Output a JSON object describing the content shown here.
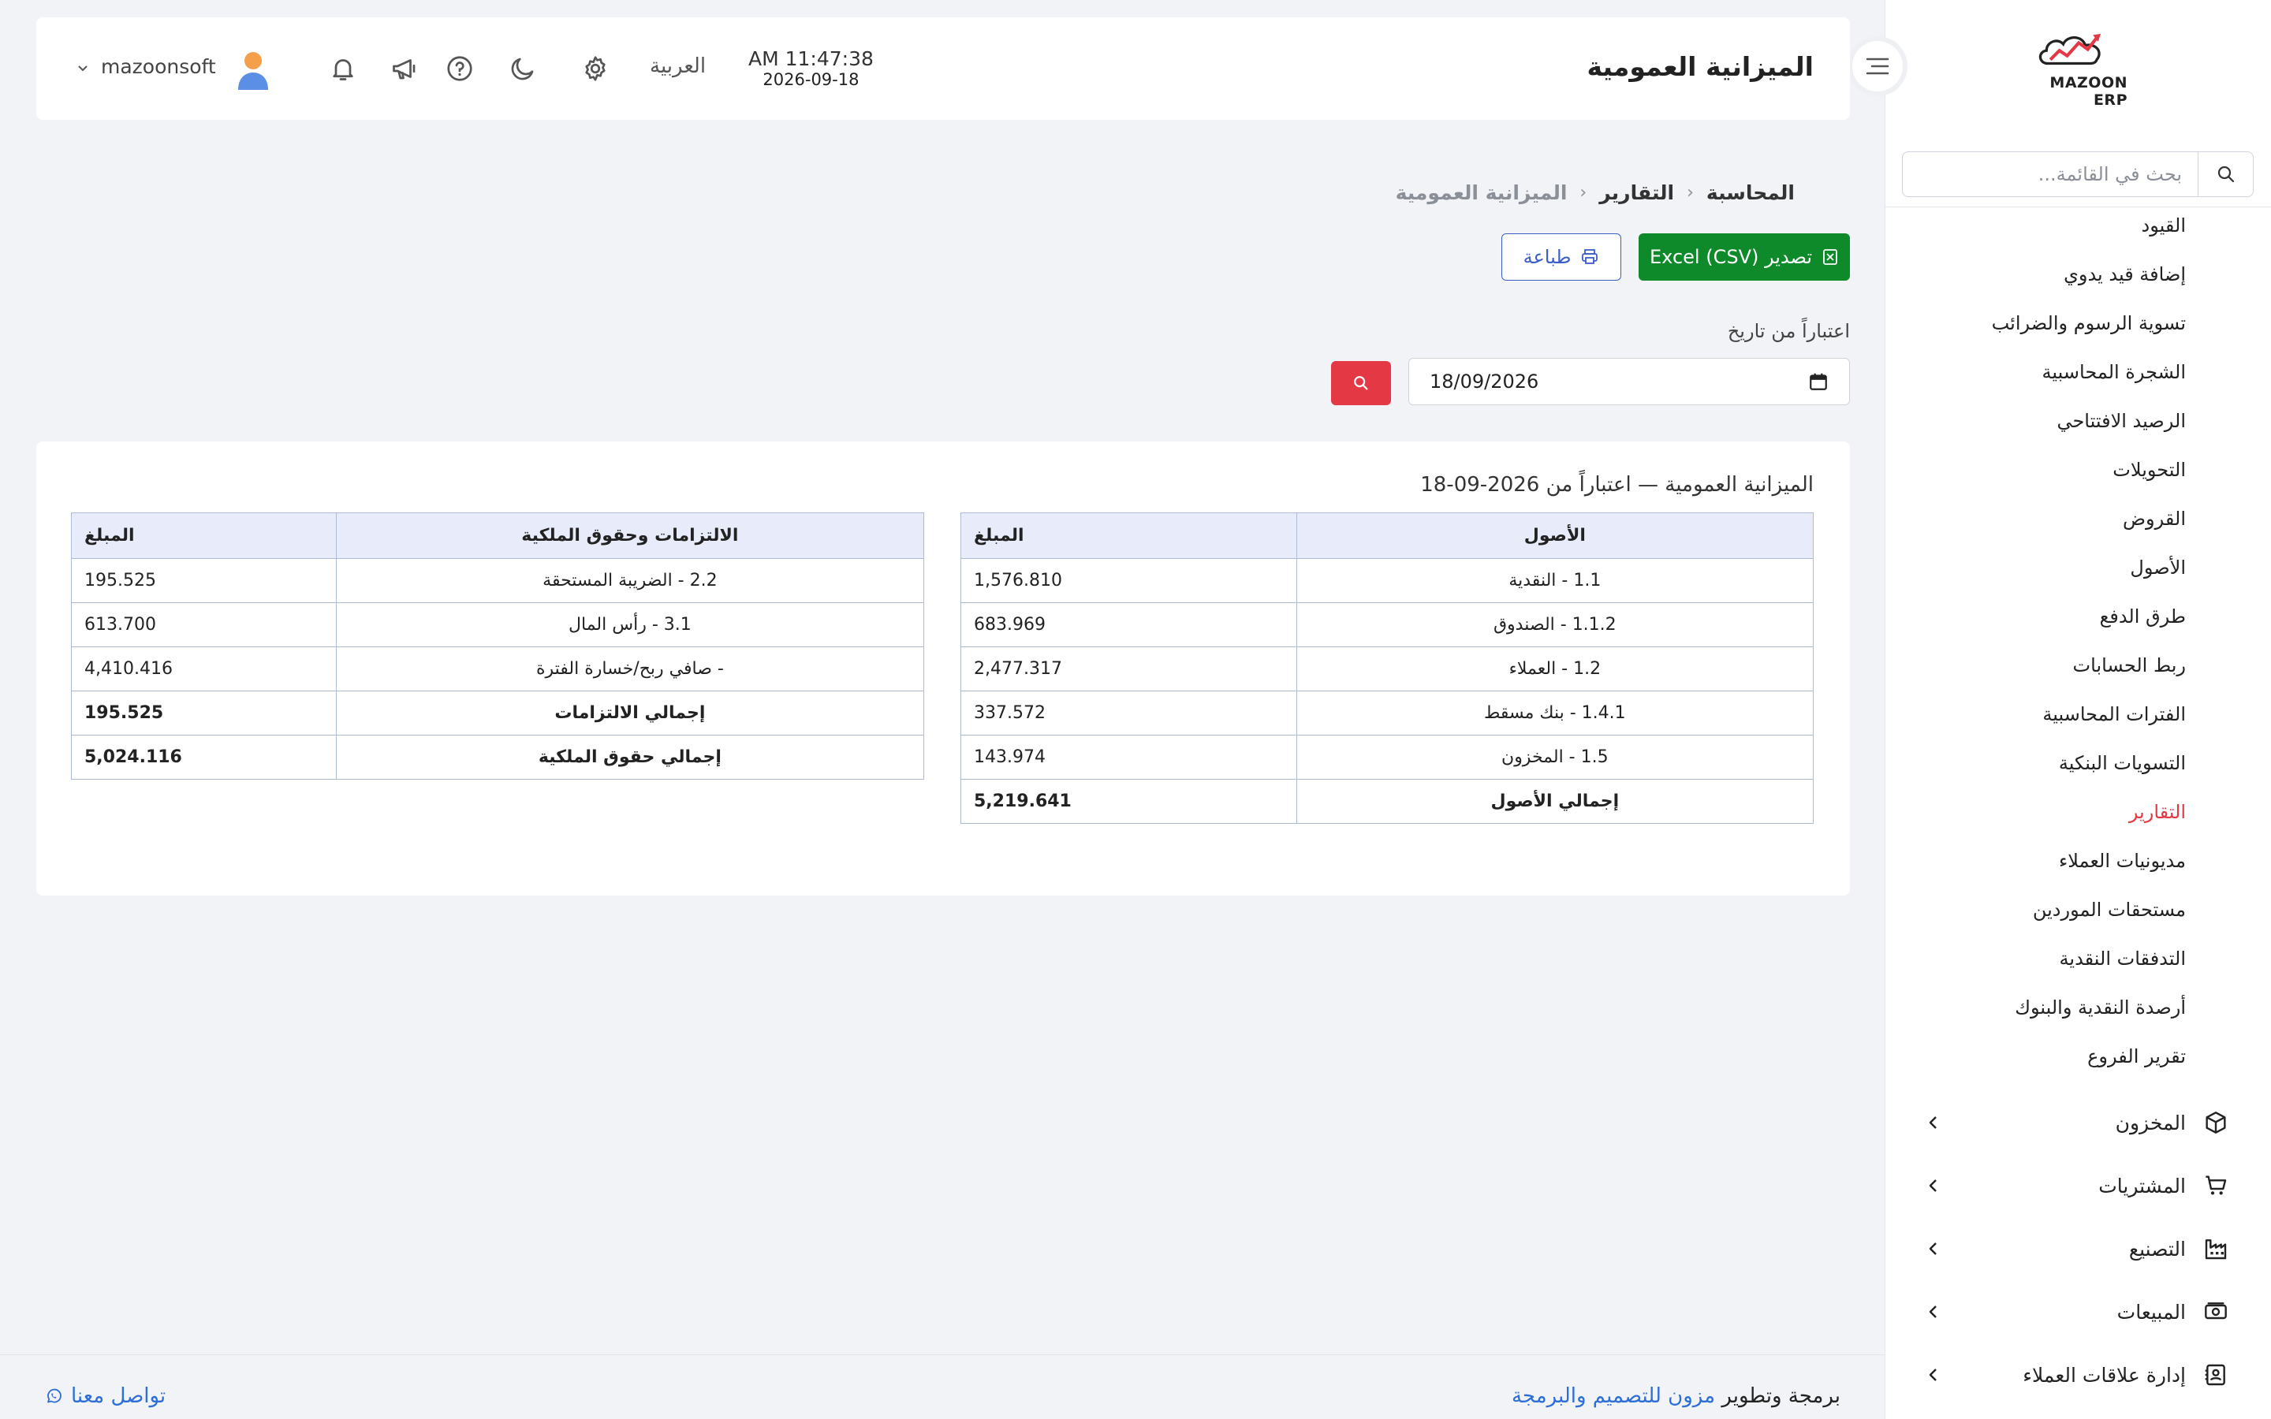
{
  "brand": {
    "logo_text": "MAZOON ERP",
    "accent_color": "#e53845"
  },
  "sidebar": {
    "search_placeholder": "بحث في القائمة...",
    "sub_items": [
      {
        "label": "القيود",
        "active": false
      },
      {
        "label": "إضافة قيد يدوي",
        "active": false
      },
      {
        "label": "تسوية الرسوم والضرائب",
        "active": false
      },
      {
        "label": "الشجرة المحاسبية",
        "active": false
      },
      {
        "label": "الرصيد الافتتاحي",
        "active": false
      },
      {
        "label": "التحويلات",
        "active": false
      },
      {
        "label": "القروض",
        "active": false
      },
      {
        "label": "الأصول",
        "active": false
      },
      {
        "label": "طرق الدفع",
        "active": false
      },
      {
        "label": "ربط الحسابات",
        "active": false
      },
      {
        "label": "الفترات المحاسبية",
        "active": false
      },
      {
        "label": "التسويات البنكية",
        "active": false
      },
      {
        "label": "التقارير",
        "active": true
      },
      {
        "label": "مديونيات العملاء",
        "active": false
      },
      {
        "label": "مستحقات الموردين",
        "active": false
      },
      {
        "label": "التدفقات النقدية",
        "active": false
      },
      {
        "label": "أرصدة النقدية والبنوك",
        "active": false
      },
      {
        "label": "تقرير الفروع",
        "active": false
      }
    ],
    "groups": [
      {
        "label": "المخزون",
        "icon": "box-icon"
      },
      {
        "label": "المشتريات",
        "icon": "cart-icon"
      },
      {
        "label": "التصنيع",
        "icon": "factory-icon"
      },
      {
        "label": "المبيعات",
        "icon": "cash-register-icon"
      },
      {
        "label": "إدارة علاقات العملاء",
        "icon": "contacts-icon"
      }
    ]
  },
  "header": {
    "title": "الميزانية العمومية",
    "time": "AM 11:47:38",
    "date": "2026-09-18",
    "language": "العربية",
    "username": "mazoonsoft"
  },
  "breadcrumb": {
    "items": [
      "المحاسبة",
      "التقارير",
      "الميزانية العمومية"
    ],
    "separator": "‹"
  },
  "actions": {
    "export_label": "تصدير Excel (CSV)",
    "print_label": "طباعة",
    "export_color": "#0e8a2a",
    "print_color": "#3a5ec8"
  },
  "filter": {
    "label": "اعتباراً من تاريخ",
    "date_value": "18/09/2026"
  },
  "report": {
    "title": "الميزانية العمومية — اعتباراً من 2026-09-18",
    "assets": {
      "headers": [
        "الأصول",
        "المبلغ"
      ],
      "rows": [
        {
          "name": "1.1 - النقدية",
          "amount": "1,576.810",
          "total": false
        },
        {
          "name": "1.1.2 - الصندوق",
          "amount": "683.969",
          "total": false
        },
        {
          "name": "1.2 - العملاء",
          "amount": "2,477.317",
          "total": false
        },
        {
          "name": "1.4.1 - بنك مسقط",
          "amount": "337.572",
          "total": false
        },
        {
          "name": "1.5 - المخزون",
          "amount": "143.974",
          "total": false
        },
        {
          "name": "إجمالي الأصول",
          "amount": "5,219.641",
          "total": true
        }
      ]
    },
    "liabilities": {
      "headers": [
        "الالتزامات وحقوق الملكية",
        "المبلغ"
      ],
      "rows": [
        {
          "name": "2.2 - الضريبة المستحقة",
          "amount": "195.525",
          "total": false
        },
        {
          "name": "3.1 - رأس المال",
          "amount": "613.700",
          "total": false
        },
        {
          "name": "- صافي ربح/خسارة الفترة",
          "amount": "4,410.416",
          "total": false
        },
        {
          "name": "إجمالي الالتزامات",
          "amount": "195.525",
          "total": true
        },
        {
          "name": "إجمالي حقوق الملكية",
          "amount": "5,024.116",
          "total": true
        }
      ]
    }
  },
  "footer": {
    "credit_prefix": "برمجة وتطوير",
    "credit_company": "مزون للتصميم والبرمجة",
    "contact_label": "تواصل معنا"
  }
}
